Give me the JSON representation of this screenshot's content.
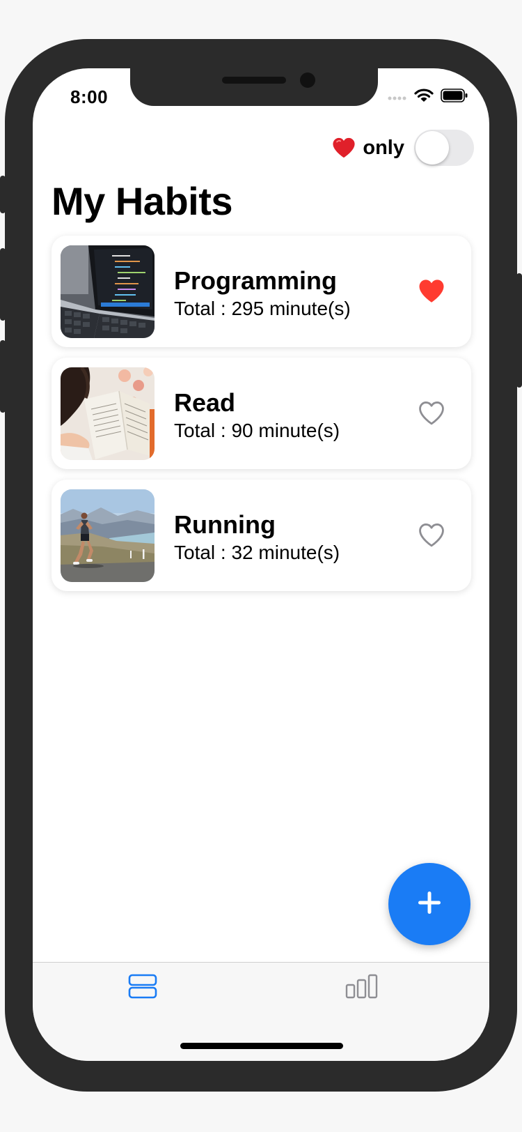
{
  "status_bar": {
    "time": "8:00"
  },
  "filter": {
    "label": "only",
    "heart_icon": "red-heart-icon",
    "enabled": false
  },
  "title": "My Habits",
  "habits": [
    {
      "name": "Programming",
      "total": "Total : 295 minute(s)",
      "favorite": true,
      "image": "laptop-code-photo"
    },
    {
      "name": "Read",
      "total": "Total : 90 minute(s)",
      "favorite": false,
      "image": "reading-book-photo"
    },
    {
      "name": "Running",
      "total": "Total : 32 minute(s)",
      "favorite": false,
      "image": "runner-photo"
    }
  ],
  "fab": {
    "icon": "plus-icon"
  },
  "tab_bar": {
    "tabs": [
      {
        "icon": "list-icon",
        "active": true
      },
      {
        "icon": "chart-icon",
        "active": false
      }
    ]
  },
  "colors": {
    "accent": "#1a7cf5",
    "favorite": "#ff3b30",
    "inactive_icon": "#8e8e93",
    "device_frame": "#2b2b2b"
  }
}
